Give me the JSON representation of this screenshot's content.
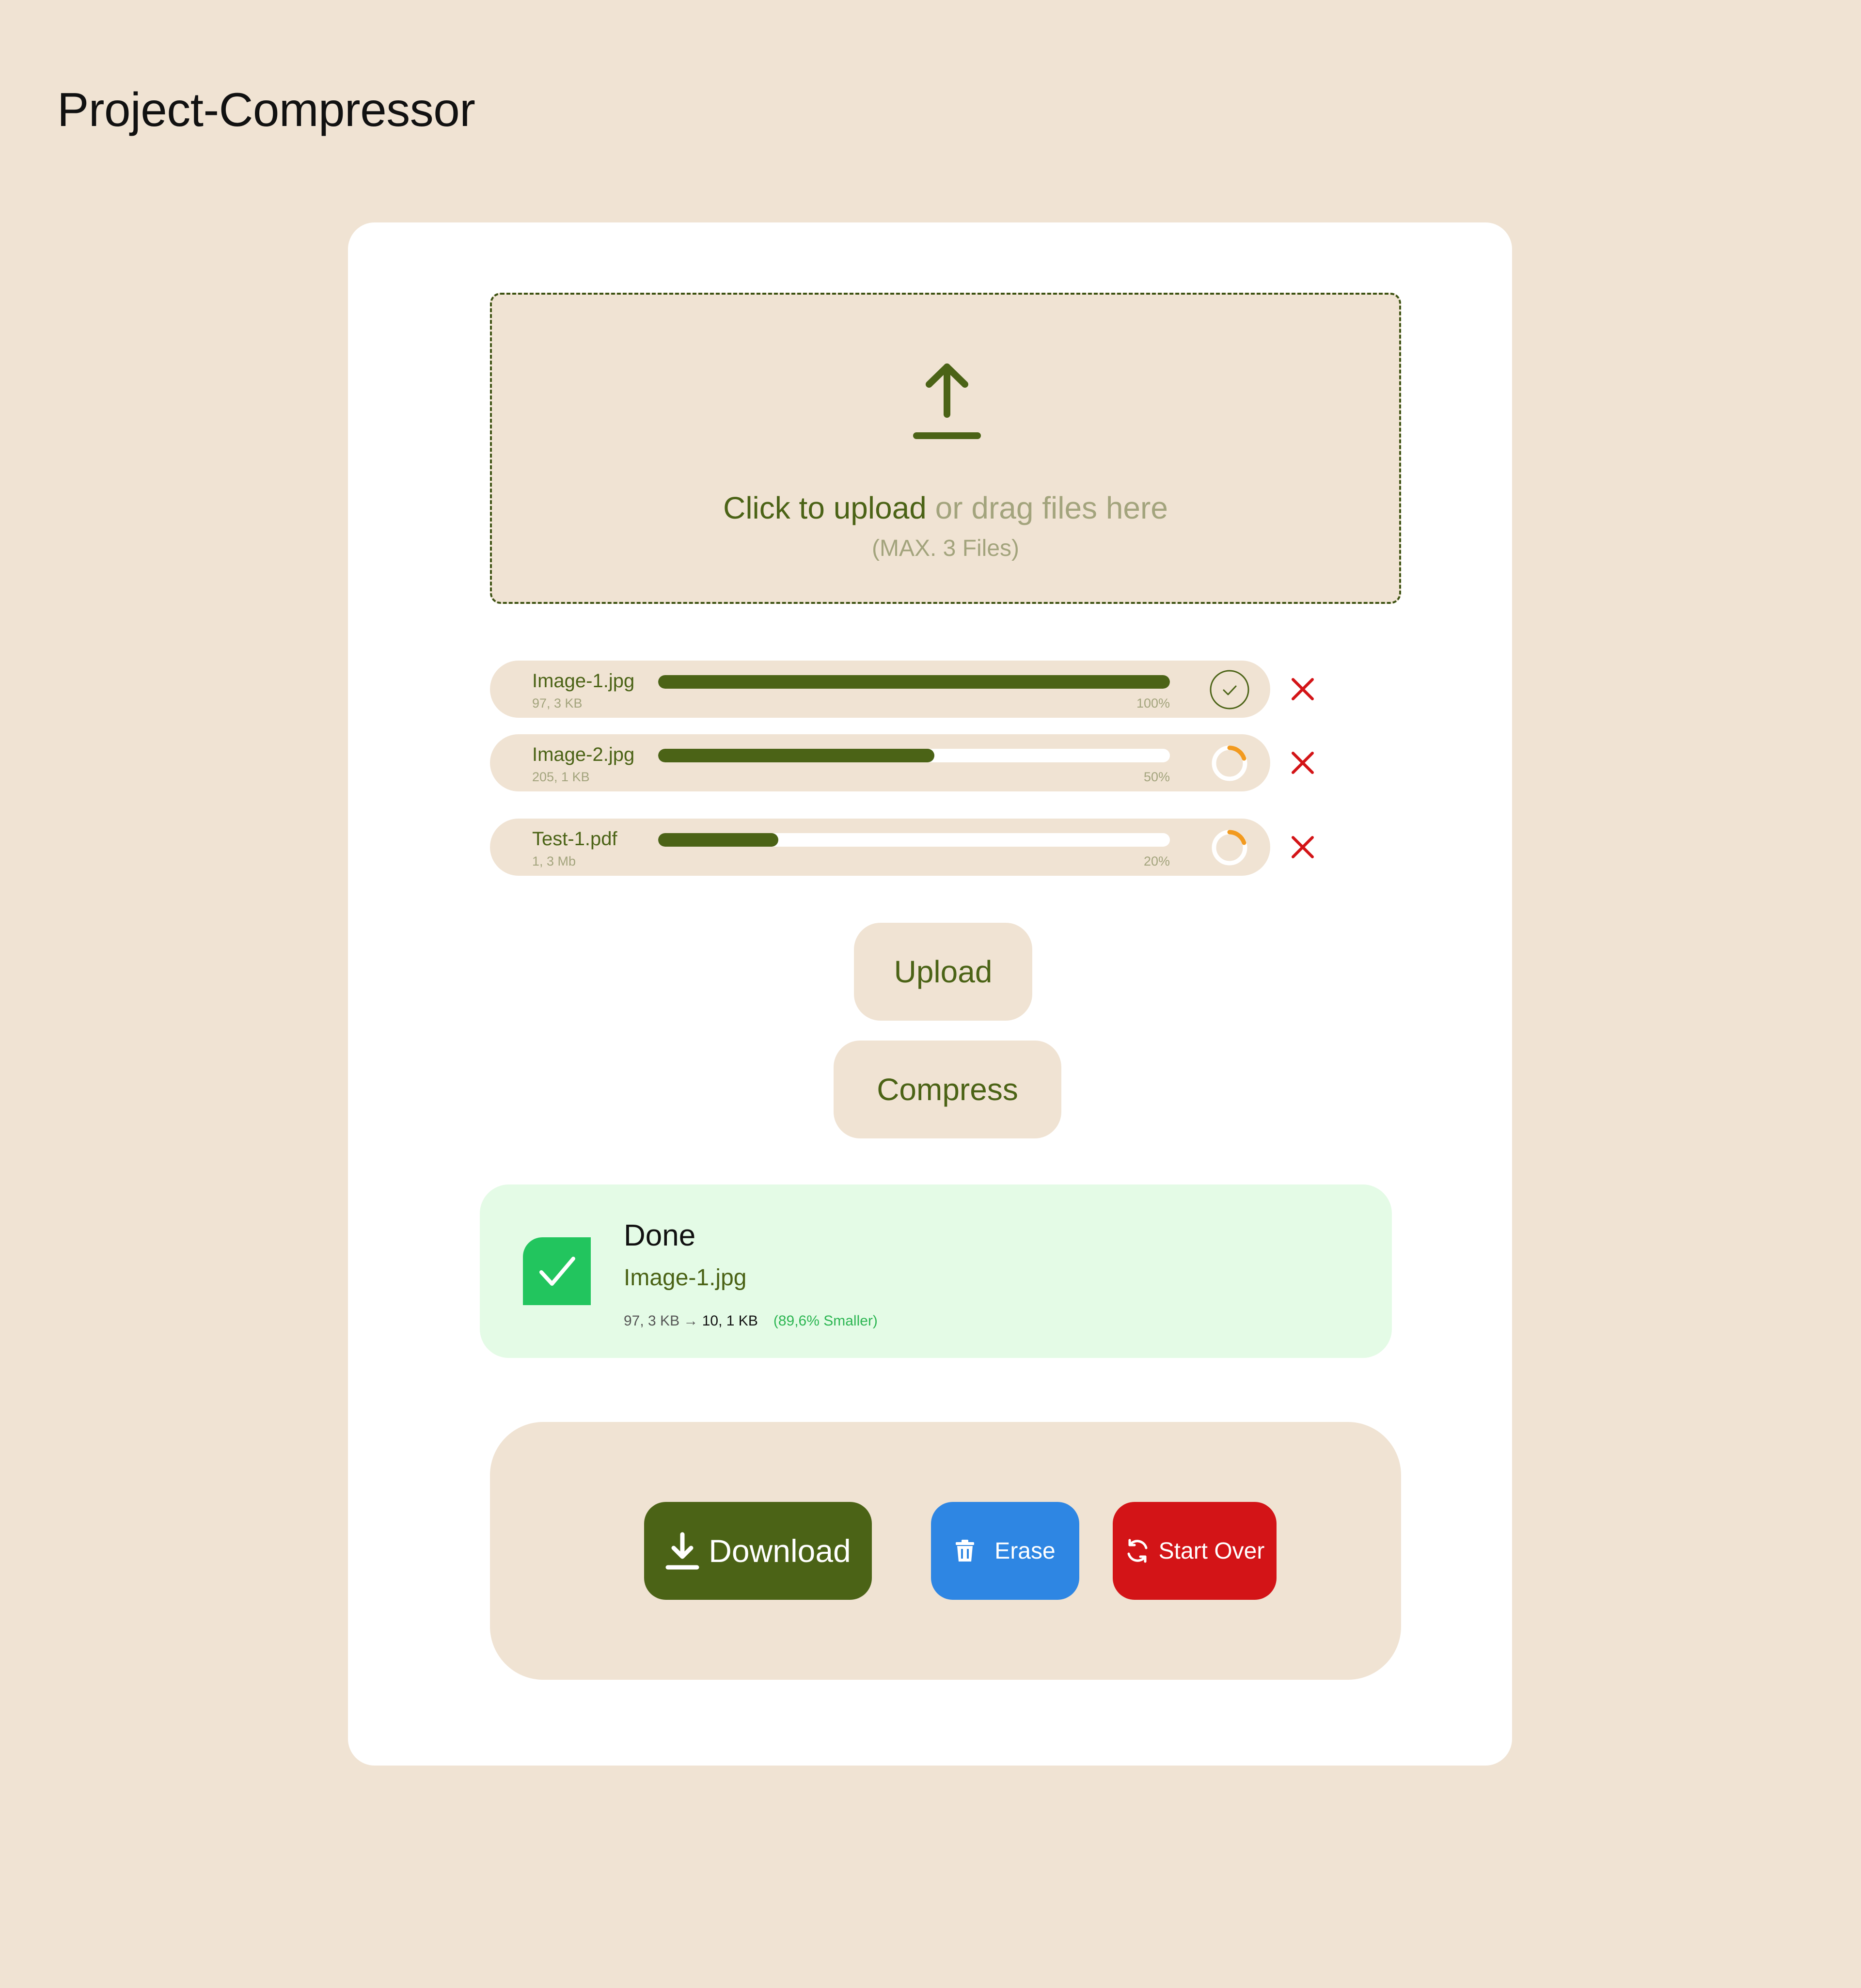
{
  "app": {
    "title": "Project-Compressor"
  },
  "dropzone": {
    "icon": "upload-arrow-icon",
    "primary_text": "Click to upload",
    "secondary_text": " or drag files here",
    "limit_text": "(MAX. 3 Files)"
  },
  "files": [
    {
      "name": "Image-1.jpg",
      "size": "97, 3 KB",
      "progress": 100,
      "progress_label": "100%",
      "status": "complete",
      "status_icon": "check-circle-icon",
      "remove_icon": "close-icon"
    },
    {
      "name": "Image-2.jpg",
      "size": "205, 1 KB",
      "progress": 54,
      "progress_label": "50%",
      "status": "uploading",
      "status_icon": "spinner-icon",
      "remove_icon": "close-icon"
    },
    {
      "name": "Test-1.pdf",
      "size": "1, 3 Mb",
      "progress": 23.5,
      "progress_label": "20%",
      "status": "uploading",
      "status_icon": "spinner-icon",
      "remove_icon": "close-icon"
    }
  ],
  "buttons": {
    "upload_label": "Upload",
    "compress_label": "Compress"
  },
  "result": {
    "icon": "success-check-icon",
    "title": "Done",
    "file_name": "Image-1.jpg",
    "size_before": "97, 3 KB",
    "arrow": " → ",
    "size_after": "10, 1 KB",
    "saving": "(89,6% Smaller)"
  },
  "actions": {
    "download_label": "Download",
    "download_icon": "download-icon",
    "erase_label": "Erase",
    "erase_icon": "trash-icon",
    "start_over_label": "Start Over",
    "start_over_icon": "refresh-icon"
  },
  "colors": {
    "background": "#F0E3D3",
    "card": "#FFFFFF",
    "primary_green": "#4B6316",
    "muted_text": "#A3A47D",
    "success_bg": "#E4FBE6",
    "success_green": "#22C55E",
    "erase_blue": "#2E86E3",
    "danger_red": "#D31417",
    "spinner_orange": "#F29A1F"
  }
}
